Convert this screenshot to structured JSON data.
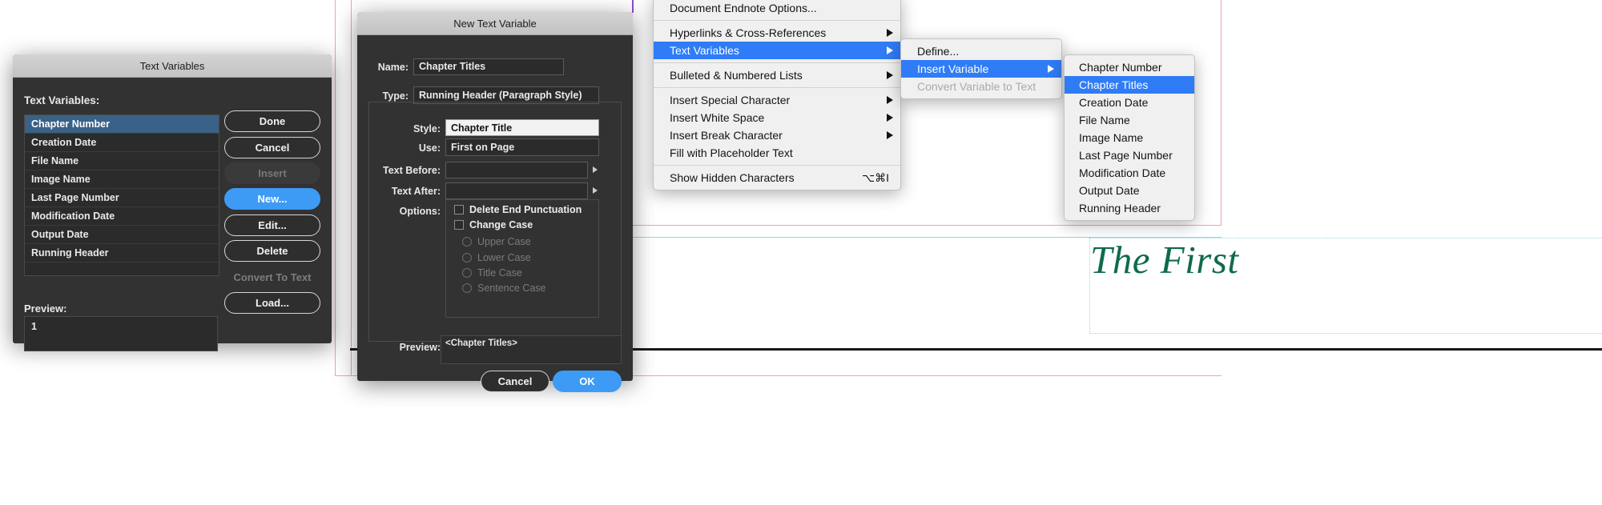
{
  "document": {
    "title_text": "The First"
  },
  "text_variables_dialog": {
    "title": "Text Variables",
    "list_label": "Text Variables:",
    "items": [
      "Chapter Number",
      "Creation Date",
      "File Name",
      "Image Name",
      "Last Page Number",
      "Modification Date",
      "Output Date",
      "Running Header"
    ],
    "selected_index": 0,
    "preview_label": "Preview:",
    "preview_value": "1",
    "buttons": [
      {
        "label": "Done",
        "style": "outline"
      },
      {
        "label": "Cancel",
        "style": "outline"
      },
      {
        "label": "Insert",
        "style": "disabled"
      },
      {
        "label": "New...",
        "style": "primary"
      },
      {
        "label": "Edit...",
        "style": "outline"
      },
      {
        "label": "Delete",
        "style": "outline"
      },
      {
        "label": "Convert To Text",
        "style": "flat-disabled"
      },
      {
        "label": "Load...",
        "style": "outline"
      }
    ]
  },
  "new_text_variable_dialog": {
    "title": "New Text Variable",
    "name_label": "Name:",
    "name_value": "Chapter Titles",
    "type_label": "Type:",
    "type_value": "Running Header (Paragraph Style)",
    "style_label": "Style:",
    "style_value": "Chapter Title",
    "use_label": "Use:",
    "use_value": "First on Page",
    "text_before_label": "Text Before:",
    "text_before_value": "",
    "text_after_label": "Text After:",
    "text_after_value": "",
    "options_label": "Options:",
    "checkboxes": [
      {
        "label": "Delete End Punctuation",
        "checked": false
      },
      {
        "label": "Change Case",
        "checked": false
      }
    ],
    "case_radios": [
      {
        "label": "Upper Case",
        "selected": false
      },
      {
        "label": "Lower Case",
        "selected": false
      },
      {
        "label": "Title Case",
        "selected": false
      },
      {
        "label": "Sentence Case",
        "selected": false
      }
    ],
    "preview_label": "Preview:",
    "preview_value": "<Chapter Titles>",
    "cancel_label": "Cancel",
    "ok_label": "OK"
  },
  "type_menu": {
    "items": [
      {
        "label": "Document Endnote Options...",
        "submenu": false,
        "selected": false,
        "shortcut": ""
      },
      {
        "separator": true
      },
      {
        "label": "Hyperlinks & Cross-References",
        "submenu": true,
        "selected": false,
        "shortcut": ""
      },
      {
        "label": "Text Variables",
        "submenu": true,
        "selected": true,
        "shortcut": ""
      },
      {
        "separator": true
      },
      {
        "label": "Bulleted & Numbered Lists",
        "submenu": true,
        "selected": false,
        "shortcut": ""
      },
      {
        "separator": true
      },
      {
        "label": "Insert Special Character",
        "submenu": true,
        "selected": false,
        "shortcut": ""
      },
      {
        "label": "Insert White Space",
        "submenu": true,
        "selected": false,
        "shortcut": ""
      },
      {
        "label": "Insert Break Character",
        "submenu": true,
        "selected": false,
        "shortcut": ""
      },
      {
        "label": "Fill with Placeholder Text",
        "submenu": false,
        "selected": false,
        "shortcut": ""
      },
      {
        "separator": true
      },
      {
        "label": "Show Hidden Characters",
        "submenu": false,
        "selected": false,
        "shortcut": "⌥⌘I"
      }
    ]
  },
  "text_variables_submenu": {
    "items": [
      {
        "label": "Define...",
        "submenu": false,
        "selected": false,
        "disabled": false
      },
      {
        "label": "Insert Variable",
        "submenu": true,
        "selected": true,
        "disabled": false
      },
      {
        "label": "Convert Variable to Text",
        "submenu": false,
        "selected": false,
        "disabled": true
      }
    ]
  },
  "insert_variable_submenu": {
    "items": [
      {
        "label": "Chapter Number",
        "selected": false
      },
      {
        "label": "Chapter Titles",
        "selected": true
      },
      {
        "label": "Creation Date",
        "selected": false
      },
      {
        "label": "File Name",
        "selected": false
      },
      {
        "label": "Image Name",
        "selected": false
      },
      {
        "label": "Last Page Number",
        "selected": false
      },
      {
        "label": "Modification Date",
        "selected": false
      },
      {
        "label": "Output Date",
        "selected": false
      },
      {
        "label": "Running Header",
        "selected": false
      }
    ]
  },
  "colors": {
    "accent_blue": "#3d9bf5",
    "menu_highlight": "#2f7cf6",
    "list_selection": "#3a6187",
    "dialog_bg": "#323232",
    "doc_title_green": "#0f6b4a",
    "guide_pink": "#f0a0b8",
    "guide_cyan": "#8fd8e8"
  }
}
